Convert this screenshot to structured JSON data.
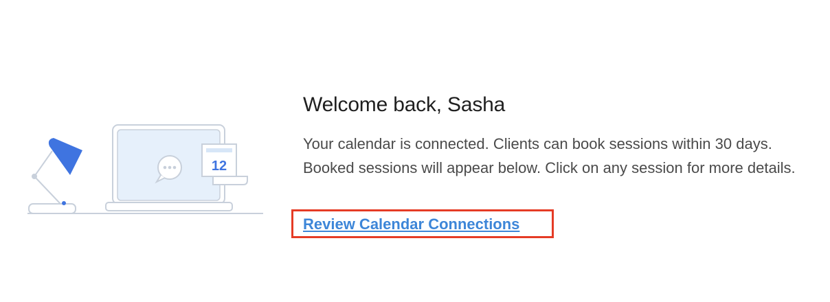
{
  "illustration": {
    "calendar_day": "12",
    "chat_icon": "chat-bubble-icon",
    "lamp_icon": "desk-lamp-icon",
    "laptop_icon": "laptop-icon",
    "calendar_icon": "calendar-icon"
  },
  "welcome": {
    "title": "Welcome back, Sasha",
    "message": "Your calendar is connected. Clients can book sessions within 30 days. Booked sessions will appear below. Click on any session for more details.",
    "link_label": "Review Calendar Connections"
  },
  "colors": {
    "link": "#3d86d8",
    "highlight_border": "#e53b25",
    "lamp": "#3f74e0",
    "outline": "#c8d0db",
    "screen_fill": "#e6f0fb"
  }
}
